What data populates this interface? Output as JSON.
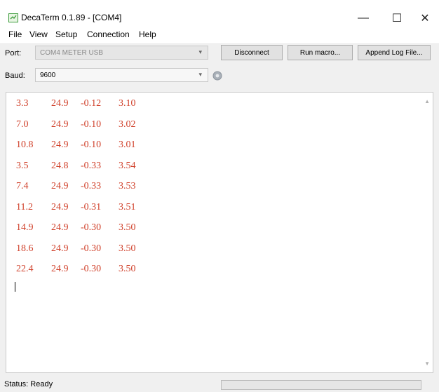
{
  "window": {
    "title": "DecaTerm 0.1.89 - [COM4]",
    "minimize_glyph": "—",
    "maximize_glyph": "☐",
    "close_glyph": "✕"
  },
  "menu": [
    "File",
    "View",
    "Setup",
    "Connection",
    "Help"
  ],
  "port": {
    "label": "Port:",
    "value": "COM4 METER USB",
    "disabled": true
  },
  "baud": {
    "label": "Baud:",
    "value": "9600"
  },
  "buttons": {
    "disconnect": "Disconnect",
    "run_macro": "Run macro...",
    "append_log": "Append Log File..."
  },
  "terminal": {
    "text_color": "#d0402a",
    "rows": [
      [
        "3.3",
        "24.9",
        "-0.12",
        "3.10"
      ],
      [
        "7.0",
        "24.9",
        "-0.10",
        "3.02"
      ],
      [
        "10.8",
        "24.9",
        "-0.10",
        "3.01"
      ],
      [
        "3.5",
        "24.8",
        "-0.33",
        "3.54"
      ],
      [
        "7.4",
        "24.9",
        "-0.33",
        "3.53"
      ],
      [
        "11.2",
        "24.9",
        "-0.31",
        "3.51"
      ],
      [
        "14.9",
        "24.9",
        "-0.30",
        "3.50"
      ],
      [
        "18.6",
        "24.9",
        "-0.30",
        "3.50"
      ],
      [
        "22.4",
        "24.9",
        "-0.30",
        "3.50"
      ]
    ]
  },
  "status": {
    "text": "Status: Ready",
    "progress": 0
  },
  "icons": {
    "app": "terminal-app-icon",
    "gear": "gear-icon"
  },
  "colors": {
    "accent": "#06b025"
  }
}
